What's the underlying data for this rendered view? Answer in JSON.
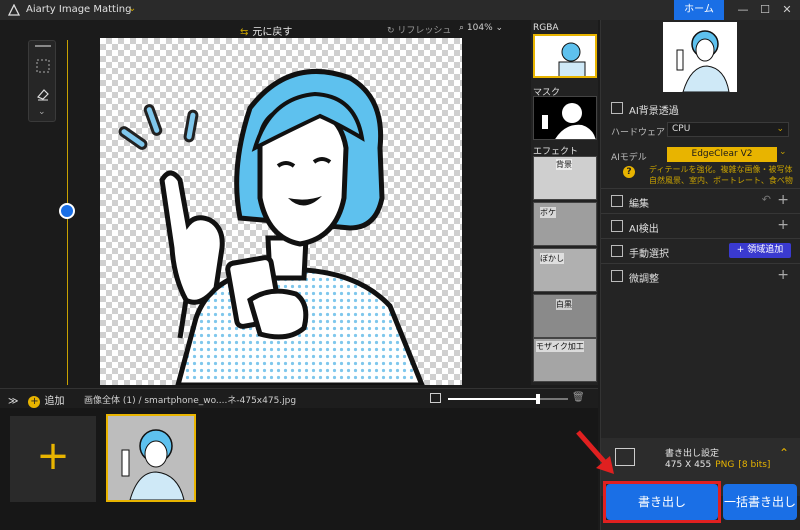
{
  "titlebar": {
    "app_title": "Aiarty Image Matting",
    "home_label": "ホーム",
    "minimize": "—",
    "maximize": "☐",
    "close": "✕"
  },
  "canvas_toolbar": {
    "undo_label": "元に戻す",
    "refresh_label": "リフレッシュ",
    "zoom_level": "104%"
  },
  "thumbnails": {
    "rgba_label": "RGBA",
    "mask_label": "マスク",
    "effect_label": "エフェクト",
    "effect_items": [
      "背景",
      "ボケ",
      "ぼかし",
      "白黒",
      "モザイク加工"
    ]
  },
  "right_panel": {
    "ai_bg_title": "AI背景透過",
    "hardware_label": "ハードウェア",
    "hardware_value": "CPU",
    "ai_model_label": "AIモデル",
    "ai_model_value": "EdgeClear V2",
    "model_desc": "ディテールを強化。複雑な画像・被写体 自然風景、室内、ポートレート、食べ物",
    "sections": {
      "edit": "編集",
      "ai_detect": "AI検出",
      "manual_select": "手動選択",
      "fine_tune": "微調整"
    },
    "region_add_label": "+ 領域追加"
  },
  "export": {
    "settings_title": "書き出し設定",
    "size": "475 X 455",
    "format": "PNG",
    "bits": "[8 bits]",
    "export_label": "書き出し",
    "batch_label": "一括書き出し"
  },
  "bottom_bar": {
    "add_label": "追加",
    "crumb": "画像全体 (1)  /  smartphone_wo....ネ-475x475.jpg"
  },
  "colors": {
    "accent_yellow": "#e8b400",
    "accent_blue": "#1a6fe6",
    "highlight_red": "#e02020"
  }
}
